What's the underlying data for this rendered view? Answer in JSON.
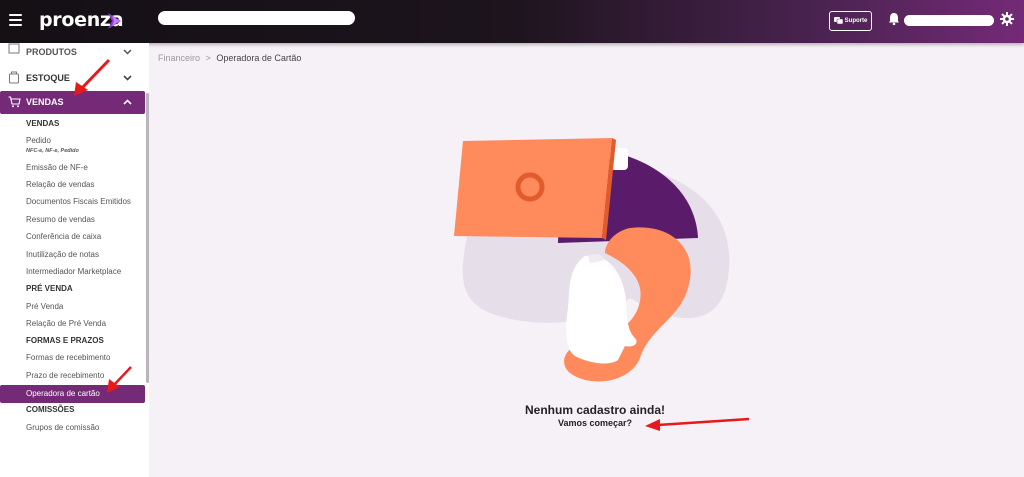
{
  "header": {
    "brand": "proenza",
    "company": "████ ████ ██████ ████████ ██████",
    "support_label": "Suporte",
    "user": "████████████████"
  },
  "sidebar": {
    "top_items": [
      {
        "label": "PRODUTOS"
      },
      {
        "label": "ESTOQUE"
      },
      {
        "label": "VENDAS"
      }
    ],
    "sections": {
      "vendas": "VENDAS",
      "pre_venda": "PRÉ VENDA",
      "formas_prazos": "FORMAS E PRAZOS",
      "comissoes": "COMISSÕES"
    },
    "vendas_items": {
      "pedido": "Pedido",
      "pedido_note": "NFC-e, NF-e, Pedido",
      "emissao": "Emissão de NF-e",
      "relacao": "Relação de vendas",
      "documentos": "Documentos Fiscais Emitidos",
      "resumo": "Resumo de vendas",
      "conferencia": "Conferência de caixa",
      "inutilizacao": "Inutilização de notas",
      "intermediador": "Intermediador Marketplace"
    },
    "pre_venda_items": {
      "pre_venda": "Pré Venda",
      "relacao_pre": "Relação de Pré Venda"
    },
    "formas_items": {
      "formas": "Formas de recebimento",
      "prazo": "Prazo de recebimento",
      "operadora": "Operadora de cartão"
    },
    "comissoes_items": {
      "grupos": "Grupos de comissão"
    }
  },
  "breadcrumb": {
    "parent": "Financeiro",
    "separator": ">",
    "current": "Operadora de Cartão"
  },
  "empty_state": {
    "title": "Nenhum cadastro ainda!",
    "subtitle": "Vamos começar?"
  },
  "colors": {
    "brand_purple": "#742a77",
    "illustration_orange": "#ff8a5c",
    "annotation_red": "#e8191b"
  }
}
